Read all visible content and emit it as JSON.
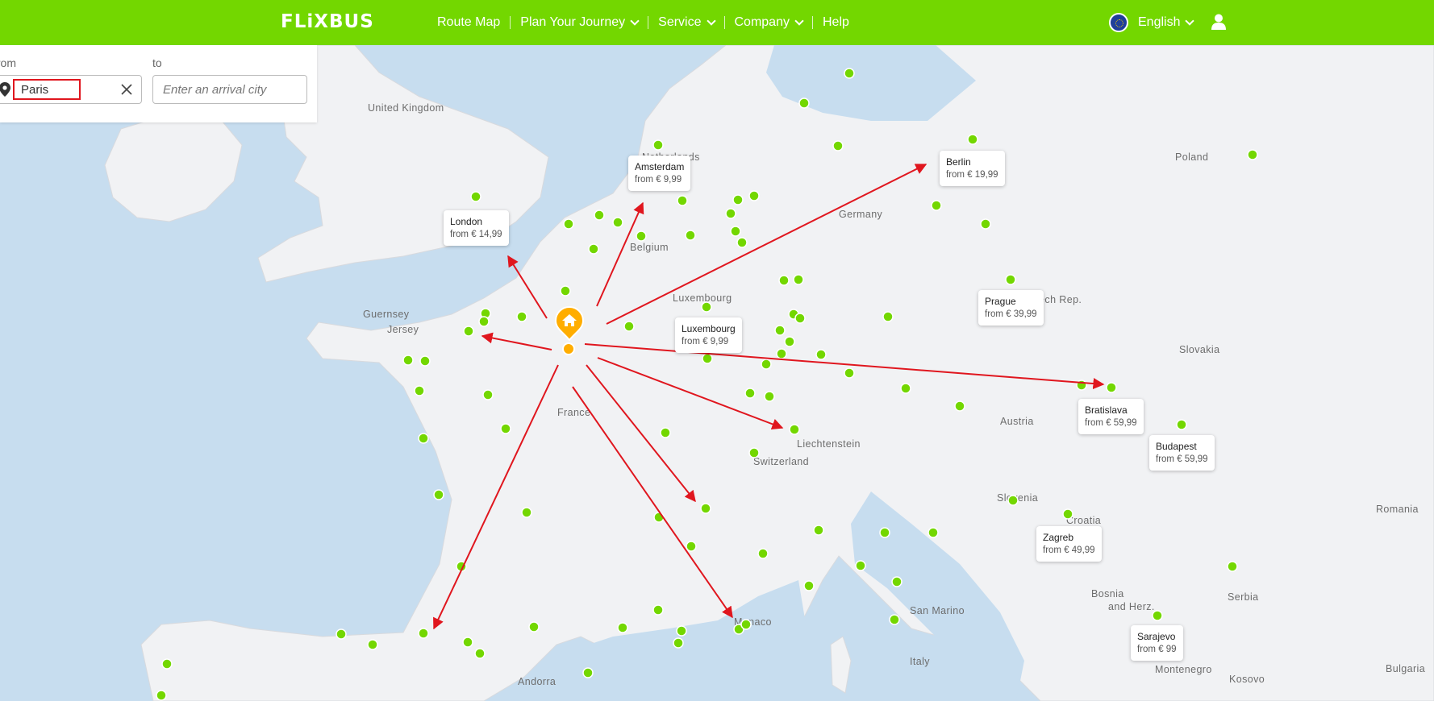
{
  "header": {
    "logo": "FLiXBUS",
    "nav": [
      {
        "label": "Route Map",
        "dropdown": false
      },
      {
        "label": "Plan Your Journey",
        "dropdown": true
      },
      {
        "label": "Service",
        "dropdown": true
      },
      {
        "label": "Company",
        "dropdown": true
      },
      {
        "label": "Help",
        "dropdown": false
      }
    ],
    "language": "English",
    "user_icon": "user-icon",
    "language_icon": "eu-flag-globe-icon"
  },
  "search": {
    "from_label": "from",
    "from_value": "Paris",
    "to_label": "to",
    "to_placeholder": "Enter an arrival city"
  },
  "colors": {
    "brand": "#73d700",
    "origin_marker": "#ffad00",
    "route_arrow": "#e0161e",
    "station_dot": "#73d700",
    "water": "#c7ddef",
    "land": "#f1f2f4"
  },
  "countries": [
    "United Kingdom",
    "Guernsey",
    "Jersey",
    "Belgium",
    "Luxembourg",
    "Germany",
    "Poland",
    "Czech Rep.",
    "Slovakia",
    "Austria",
    "Liechtenstein",
    "Switzerland",
    "France",
    "Slovenia",
    "Croatia",
    "Romania",
    "Bosnia",
    "and Herz.",
    "Serbia",
    "San Marino",
    "Italy",
    "Monaco",
    "Andorra",
    "Montenegro",
    "Kosovo",
    "Bulgaria",
    "Netherlands"
  ],
  "destinations": [
    {
      "city": "London",
      "price": "from € 14,99"
    },
    {
      "city": "Amsterdam",
      "price": "from € 9,99"
    },
    {
      "city": "Berlin",
      "price": "from € 19,99"
    },
    {
      "city": "Prague",
      "price": "from € 39,99"
    },
    {
      "city": "Luxembourg",
      "price": "from € 9,99"
    },
    {
      "city": "Bratislava",
      "price": "from € 59,99"
    },
    {
      "city": "Budapest",
      "price": "from € 59,99"
    },
    {
      "city": "Zagreb",
      "price": "from € 49,99"
    },
    {
      "city": "Sarajevo",
      "price": "from € 99"
    }
  ]
}
